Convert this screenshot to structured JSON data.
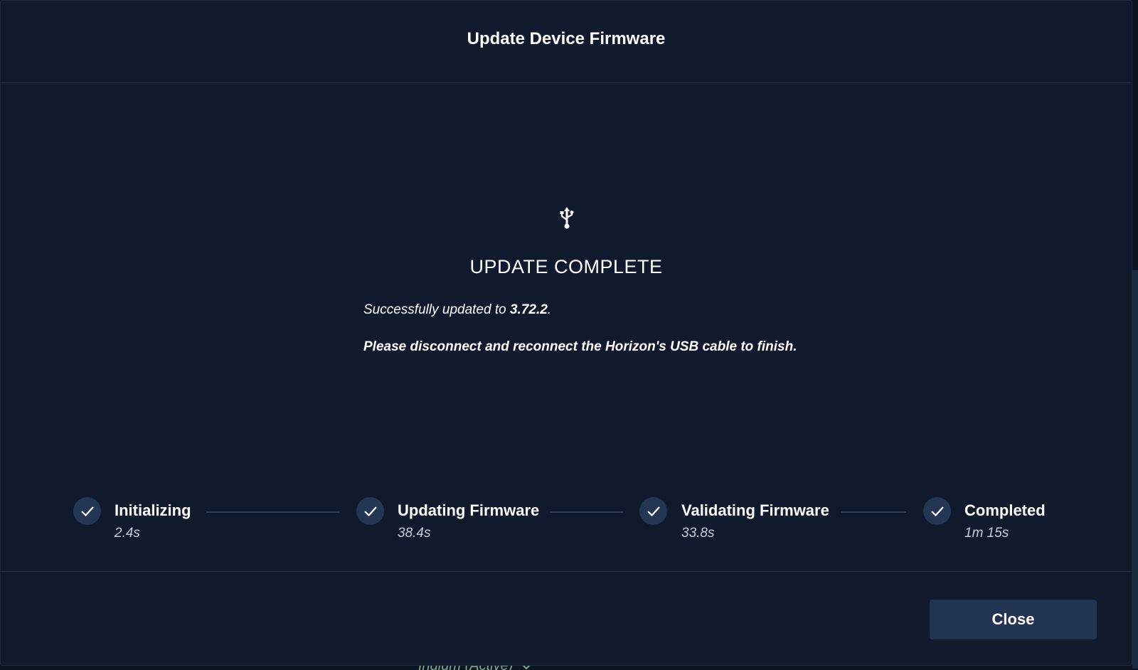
{
  "dialog": {
    "title": "Update Device Firmware",
    "icon": "usb-icon",
    "status_heading": "UPDATE COMPLETE",
    "message_prefix": "Successfully updated to ",
    "version": "3.72.2",
    "message_suffix": ".",
    "instruction": "Please disconnect and reconnect the Horizon's USB cable to finish.",
    "close_label": "Close"
  },
  "steps": [
    {
      "label": "Initializing",
      "time": "2.4s",
      "icon": "check-icon"
    },
    {
      "label": "Updating Firmware",
      "time": "38.4s",
      "icon": "check-icon"
    },
    {
      "label": "Validating Firmware",
      "time": "33.8s",
      "icon": "check-icon"
    },
    {
      "label": "Completed",
      "time": "1m 15s",
      "icon": "check-icon"
    }
  ],
  "background": {
    "partial_text": "Iridium (Active)"
  },
  "colors": {
    "modal_bg": "#101a2c",
    "step_circle": "#243654",
    "button_bg": "#223454",
    "background_text": "#7fa88a"
  }
}
